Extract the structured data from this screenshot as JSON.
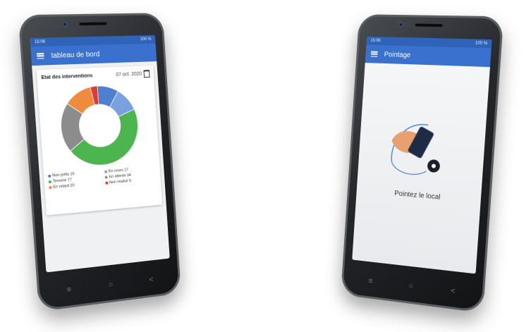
{
  "left_phone": {
    "status_bar": {
      "time": "15:06",
      "right": "100 %"
    },
    "app_bar": {
      "title": "tableau de bord",
      "icon": "menu-icon"
    },
    "card": {
      "title": "Etat des interventions",
      "date": "07 oct. 2020",
      "calendar_icon": "calendar-icon"
    },
    "chart_data": {
      "type": "pie",
      "donut": true,
      "slices": [
        {
          "name": "Non prêts",
          "value": 15,
          "color": "#4f7fd0"
        },
        {
          "name": "En cours",
          "value": 17,
          "color": "#7aa0e0"
        },
        {
          "name": "Terminé",
          "value": 77,
          "color": "#4cb54f"
        },
        {
          "name": "En attente",
          "value": 34,
          "color": "#8c8c8c"
        },
        {
          "name": "En retard",
          "value": 20,
          "color": "#f08a3c"
        },
        {
          "name": "Non réalisé",
          "value": 5,
          "color": "#e03a34"
        }
      ]
    },
    "legend": [
      {
        "label": "Non prêts",
        "value": "15",
        "color": "#4f7fd0"
      },
      {
        "label": "En cours",
        "value": "17",
        "color": "#7aa0e0"
      },
      {
        "label": "Terminé",
        "value": "77",
        "color": "#4cb54f"
      },
      {
        "label": "En attente",
        "value": "34",
        "color": "#8c8c8c"
      },
      {
        "label": "En retard",
        "value": "20",
        "color": "#f08a3c"
      },
      {
        "label": "Non réalisé",
        "value": "5",
        "color": "#e03a34"
      }
    ],
    "nav": {
      "recent": "≡",
      "home": "○",
      "back": "<"
    }
  },
  "right_phone": {
    "status_bar": {
      "time": "15:06",
      "right": "100 %"
    },
    "app_bar": {
      "title": "Pointage",
      "icon": "menu-icon"
    },
    "prompt": "Pointez le local",
    "illustration_icon": "hand-phone-nfc-icon",
    "nav": {
      "recent": "≡",
      "home": "○",
      "back": "<"
    }
  }
}
